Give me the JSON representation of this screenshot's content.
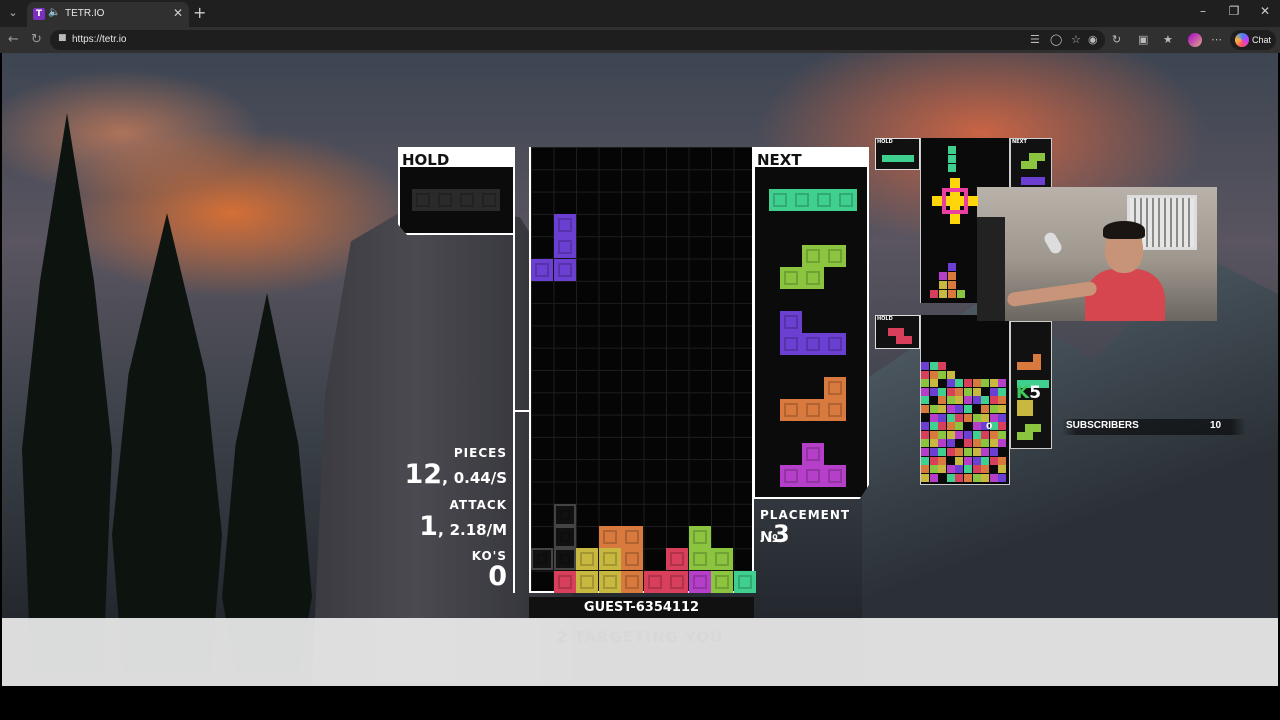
{
  "browser": {
    "tab_title": "TETR.IO",
    "url": "https://tetr.io",
    "chat_label": "Chat"
  },
  "game": {
    "hold": {
      "label": "HOLD",
      "piece": "I"
    },
    "next": {
      "label": "NEXT",
      "pieces": [
        "I",
        "S",
        "J",
        "L",
        "T"
      ]
    },
    "stats": {
      "pieces_label": "PIECES",
      "pieces_value": "12",
      "pieces_rate": "0.44/S",
      "attack_label": "ATTACK",
      "attack_value": "1",
      "attack_rate": "2.18/M",
      "kos_label": "KO'S",
      "kos_value": "0"
    },
    "placement": {
      "label": "PLACEMENT",
      "value": "3",
      "prefix": "№"
    },
    "player_name": "GUEST-6354112",
    "targeting_text": "2 TARGETING YOU",
    "colors": {
      "I": "#3fcf8e",
      "S": "#8bc53f",
      "J": "#6a3fd1",
      "L": "#d87a3e",
      "T": "#b53fc9",
      "Z": "#d83f5a",
      "O": "#c9b83f",
      "garbage": "#303030"
    }
  },
  "opponents": {
    "hold_label": "HOLD",
    "next_label": "NEXT",
    "opp2_zero": "0",
    "ko_badge_k": "K",
    "ko_badge_count": "5"
  },
  "overlay": {
    "subscribers_label": "SUBSCRIBERS",
    "subscribers_count": "10"
  }
}
